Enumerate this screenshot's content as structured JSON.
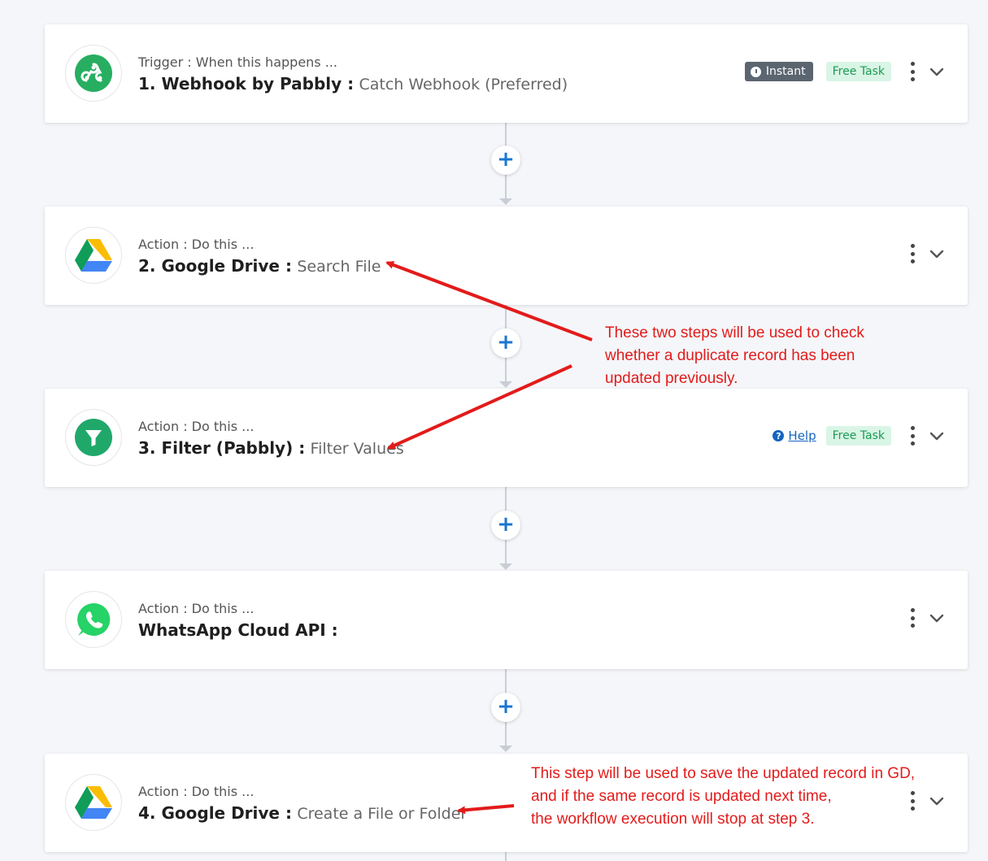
{
  "steps": [
    {
      "kind": "Trigger : When this happens ...",
      "app": "1. Webhook by Pabbly :",
      "event": "Catch Webhook (Preferred)",
      "instant": "Instant",
      "free_task": "Free Task"
    },
    {
      "kind": "Action : Do this ...",
      "app": "2. Google Drive :",
      "event": "Search File"
    },
    {
      "kind": "Action : Do this ...",
      "app": "3. Filter (Pabbly) :",
      "event": "Filter Values",
      "help": "Help",
      "free_task": "Free Task"
    },
    {
      "kind": "Action : Do this ...",
      "app": "WhatsApp Cloud API :",
      "event": ""
    },
    {
      "kind": "Action : Do this ...",
      "app": "4. Google Drive :",
      "event": "Create a File or Folder"
    }
  ],
  "add_step_symbol": "+",
  "annotations": {
    "note1": [
      "These two steps will be used to check",
      "whether a duplicate record has been",
      "updated previously."
    ],
    "note2": [
      "This step will be used to save the updated record in GD,",
      "and if the same record is updated next time,",
      "the workflow execution will stop at step 3."
    ]
  },
  "colors": {
    "accent": "#1976d2",
    "annotation": "#e31b1b",
    "free_task_bg": "#d9f5e5",
    "free_task_text": "#1d9a55",
    "instant_bg": "#5b6570"
  }
}
